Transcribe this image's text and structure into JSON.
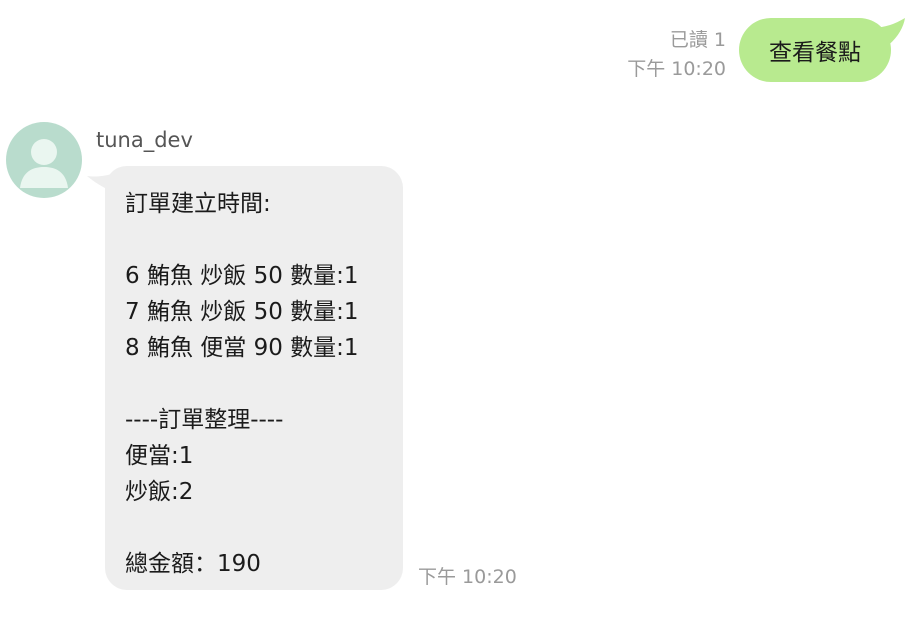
{
  "outgoing": {
    "read_status": "已讀 1",
    "time": "下午 10:20",
    "text": "查看餐點"
  },
  "incoming": {
    "sender": "tuna_dev",
    "time": "下午 10:20",
    "lines": [
      "訂單建立時間:",
      "",
      "6 鮪魚 炒飯 50 數量:1",
      "7 鮪魚 炒飯 50 數量:1",
      "8 鮪魚 便當 90 數量:1",
      "",
      "----訂單整理----",
      "便當:1",
      "炒飯:2",
      "",
      "總金額：190"
    ]
  },
  "colors": {
    "outgoing_bubble": "#b8ea8f",
    "incoming_bubble": "#eeeeee",
    "avatar_bg": "#b9dccd",
    "meta_text": "#9a9a9a"
  },
  "icons": {
    "avatar": "default-user-avatar-icon"
  }
}
